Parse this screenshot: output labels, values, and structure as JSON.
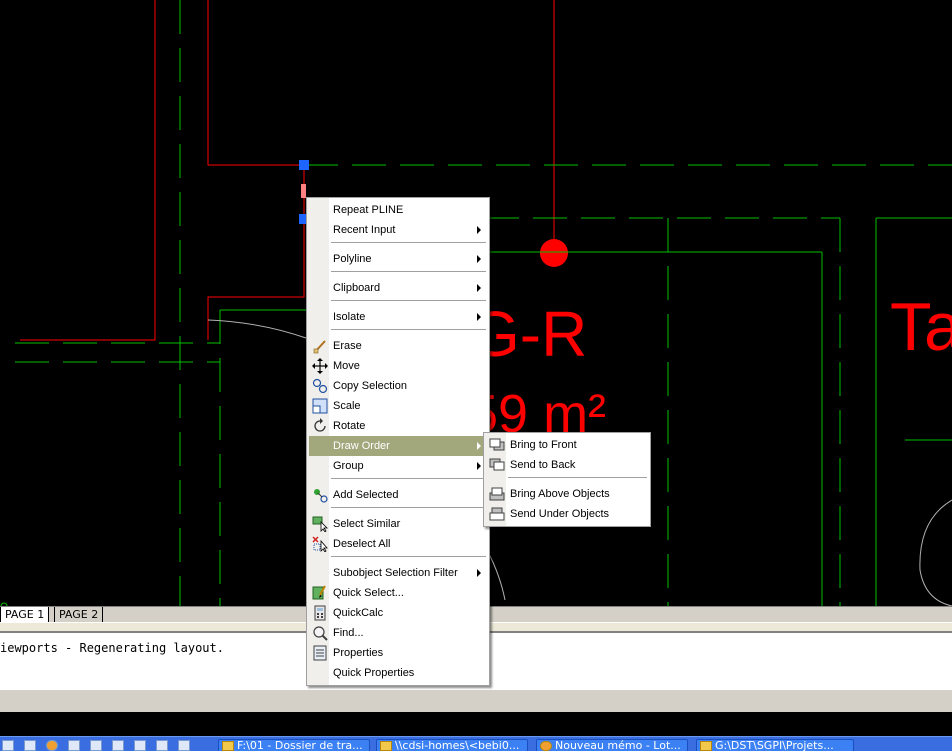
{
  "drawing": {
    "room_label": "G-R",
    "area_label": "59 m²",
    "right_label": "Ta"
  },
  "layout_tabs": [
    "PAGE 1",
    "PAGE 2"
  ],
  "command_line": {
    "text": "iewports - Regenerating layout."
  },
  "context_menu": {
    "items": [
      {
        "label": "Repeat PLINE",
        "submenu": false
      },
      {
        "label": "Recent Input",
        "submenu": true
      },
      {
        "label": "Polyline",
        "submenu": true
      },
      {
        "label": "Clipboard",
        "submenu": true
      },
      {
        "label": "Isolate",
        "submenu": true
      },
      {
        "label": "Erase",
        "icon": "erase-icon"
      },
      {
        "label": "Move",
        "icon": "move-icon"
      },
      {
        "label": "Copy Selection",
        "icon": "copy-icon"
      },
      {
        "label": "Scale",
        "icon": "scale-icon"
      },
      {
        "label": "Rotate",
        "icon": "rotate-icon"
      },
      {
        "label": "Draw Order",
        "submenu": true,
        "highlighted": true
      },
      {
        "label": "Group",
        "submenu": true
      },
      {
        "label": "Add Selected",
        "icon": "add-selected-icon"
      },
      {
        "label": "Select Similar",
        "icon": "select-similar-icon"
      },
      {
        "label": "Deselect All",
        "icon": "deselect-icon"
      },
      {
        "label": "Subobject Selection Filter",
        "submenu": true
      },
      {
        "label": "Quick Select...",
        "icon": "quick-select-icon"
      },
      {
        "label": "QuickCalc",
        "icon": "calculator-icon"
      },
      {
        "label": "Find...",
        "icon": "find-icon"
      },
      {
        "label": "Properties",
        "icon": "properties-icon"
      },
      {
        "label": "Quick Properties"
      }
    ]
  },
  "draw_order_submenu": {
    "items": [
      {
        "label": "Bring to Front",
        "icon": "bring-to-front-icon"
      },
      {
        "label": "Send to Back",
        "icon": "send-to-back-icon"
      },
      {
        "label": "Bring Above Objects",
        "icon": "bring-above-icon"
      },
      {
        "label": "Send Under Objects",
        "icon": "send-under-icon"
      }
    ]
  },
  "taskbar": {
    "items": [
      "F:\\01 - Dossier de tra...",
      "\\\\cdsi-homes\\<bebi0...",
      "Nouveau mémo - Lot...",
      "G:\\DST\\SGPI\\Projets..."
    ]
  },
  "colors": {
    "canvas": "#000000",
    "red_lines": "#ff0000",
    "green_lines": "#00c000",
    "grip": "#1e64ff",
    "menu_highlight": "#a2a77c"
  }
}
